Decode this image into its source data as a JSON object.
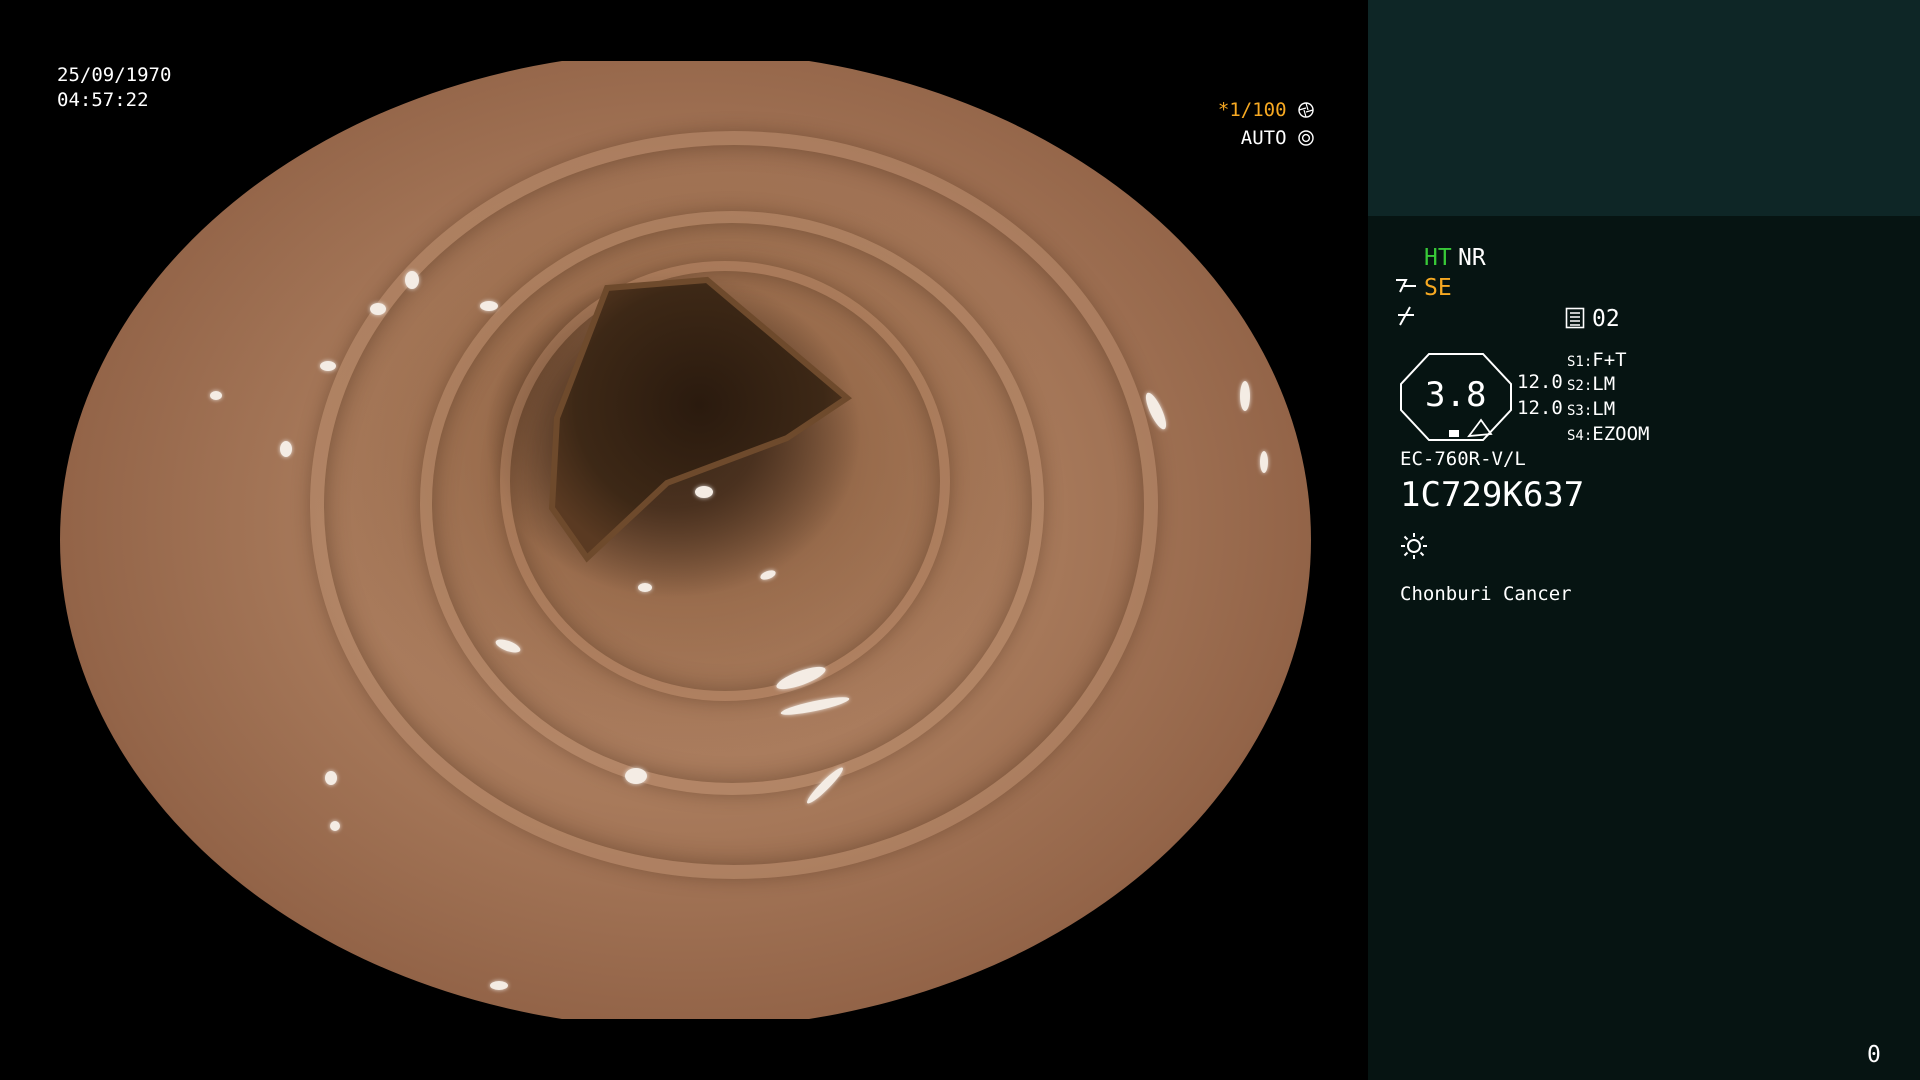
{
  "overlay": {
    "date": "25/09/1970",
    "time": "04:57:22",
    "shutter_star": "*",
    "shutter_value": "1/100",
    "shutter_icon": "aperture-icon",
    "iris_mode": "AUTO",
    "iris_icon": "iris-icon"
  },
  "panel": {
    "ht_label": "HT",
    "nr_label": "NR",
    "se_label": "SE",
    "memory_icon": "memory-card-icon",
    "memory_value": "02",
    "dial_value": "3.8",
    "value_1": "12.0",
    "value_2": "12.0",
    "slots": [
      {
        "key": "S1:",
        "value": "F+T"
      },
      {
        "key": "S2:",
        "value": "LM"
      },
      {
        "key": "S3:",
        "value": "LM"
      },
      {
        "key": "S4:",
        "value": "EZOOM"
      }
    ],
    "scope_model": "EC-760R-V/L",
    "scope_serial": "1C729K637",
    "light_icon": "sun-icon",
    "hospital_name": "Chonburi Cancer",
    "frame_counter": "0"
  },
  "colors": {
    "ht_green": "#38c938",
    "accent_orange": "#f7a922",
    "panel_dark": "#061412",
    "panel_top": "#0e2626"
  }
}
